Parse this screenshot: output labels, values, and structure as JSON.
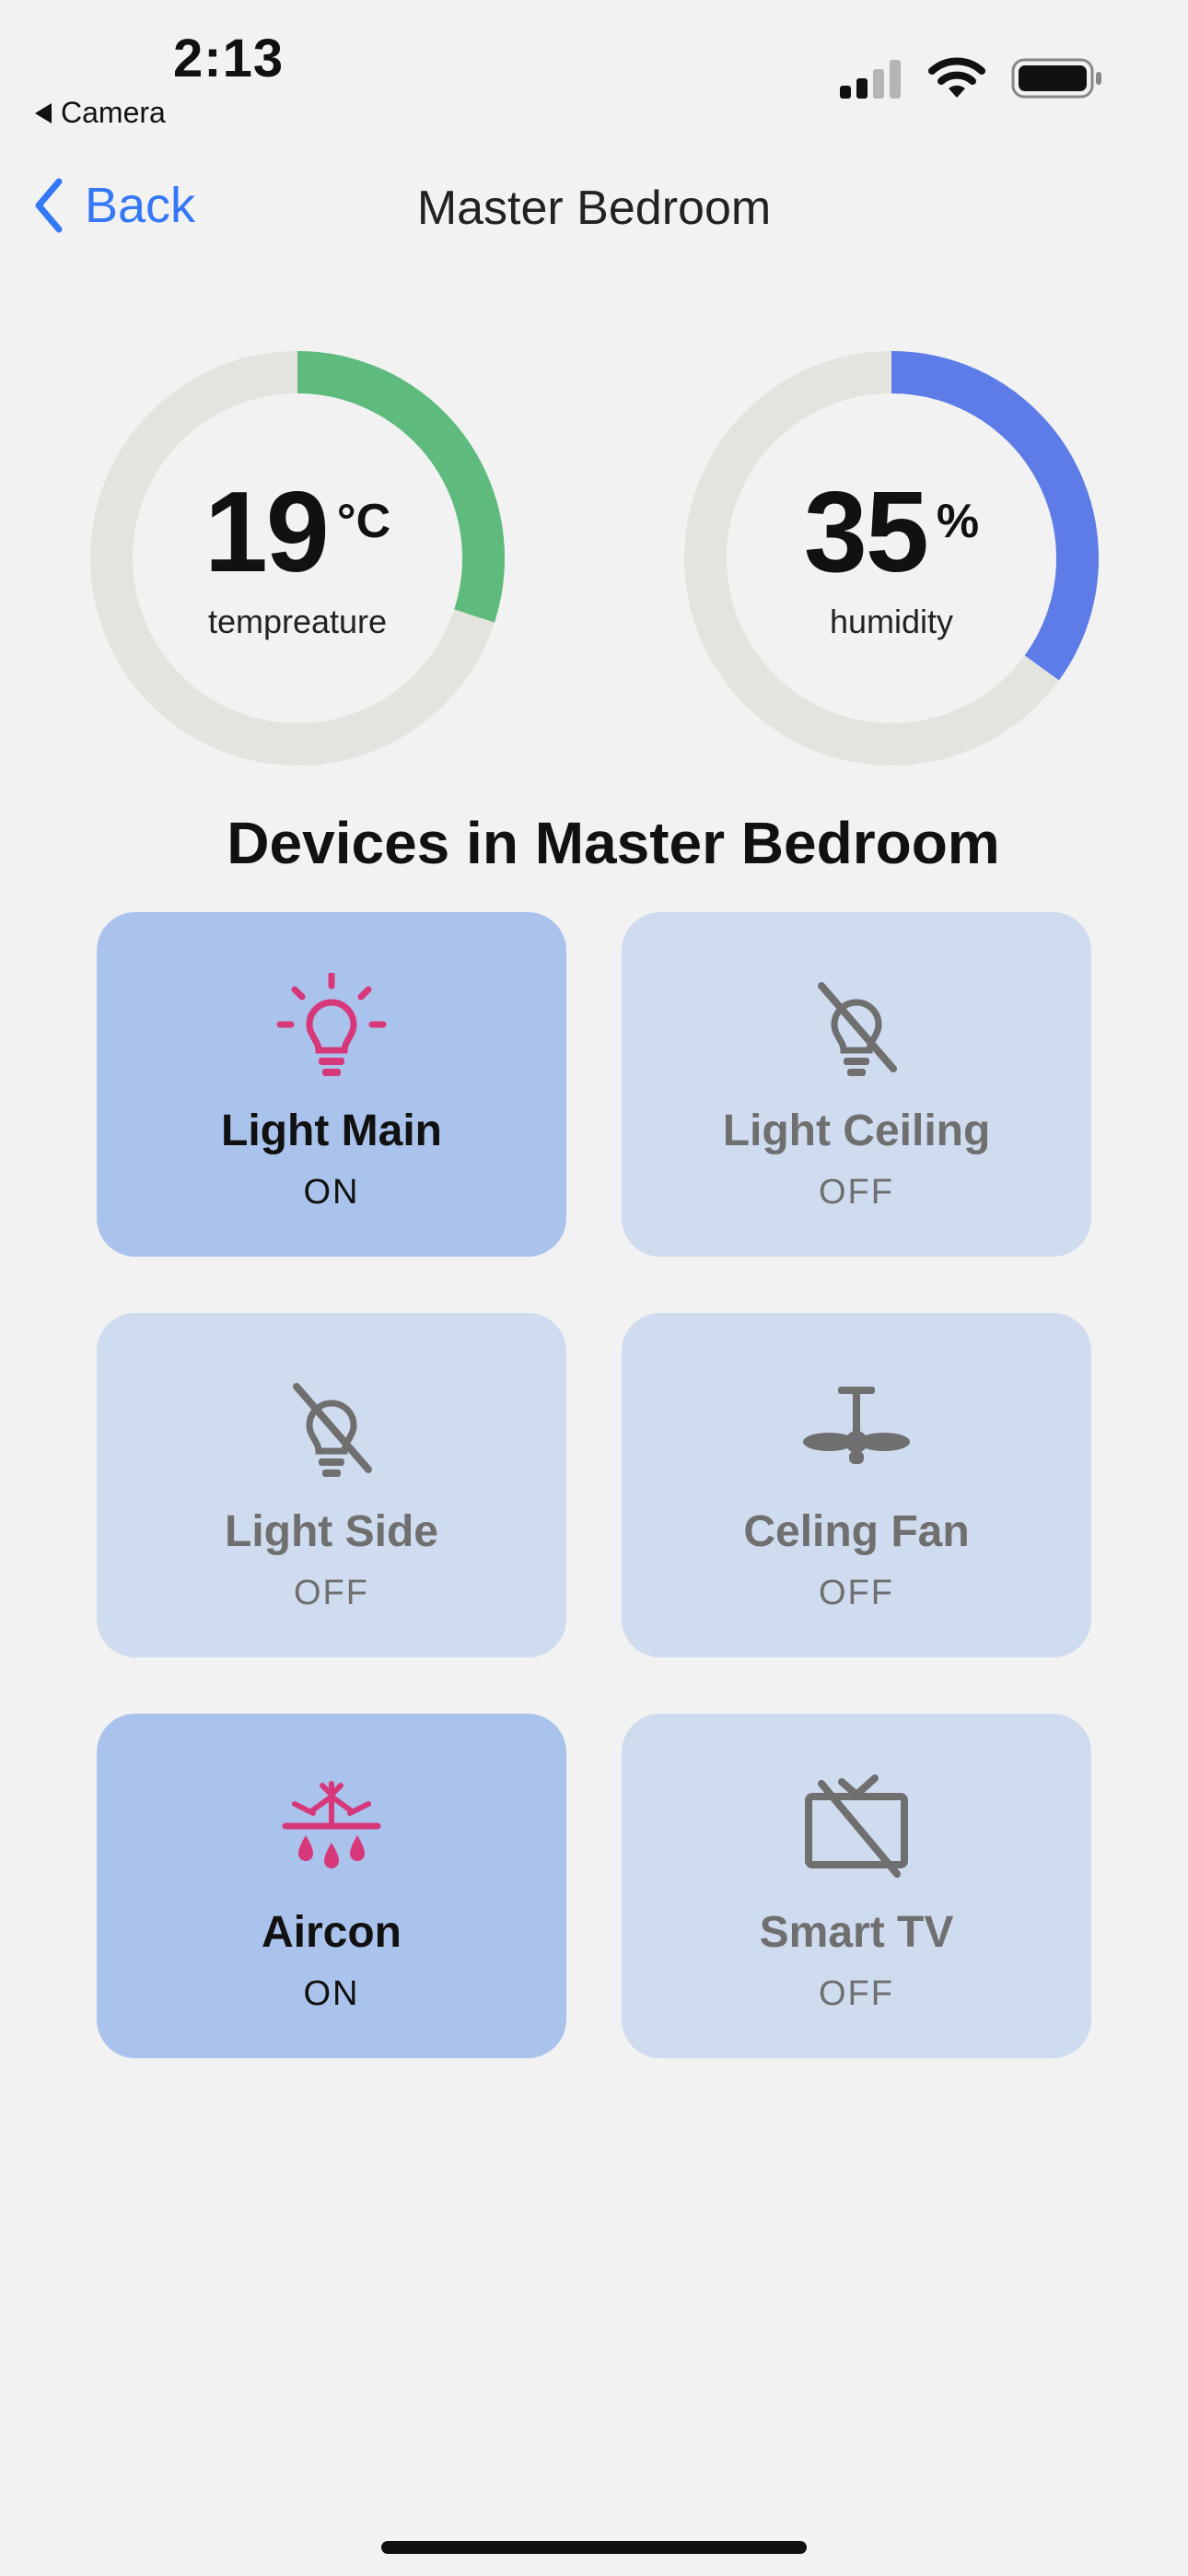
{
  "status_bar": {
    "time": "2:13",
    "back_app": "Camera",
    "icons": [
      "cellular-signal-icon",
      "wifi-icon",
      "battery-icon"
    ]
  },
  "nav": {
    "back_label": "Back",
    "title": "Master Bedroom"
  },
  "gauges": {
    "temperature": {
      "value": "19",
      "unit": "°C",
      "label": "tempreature",
      "fill_fraction": 0.3,
      "color": "#5ebb7d"
    },
    "humidity": {
      "value": "35",
      "unit": "%",
      "label": "humidity",
      "fill_fraction": 0.35,
      "color": "#5e7ce8"
    },
    "track_color": "#e4e4de"
  },
  "section_title": "Devices in Master Bedroom",
  "devices": [
    {
      "name": "Light Main",
      "state": "ON",
      "icon": "lightbulb-on-icon"
    },
    {
      "name": "Light Ceiling",
      "state": "OFF",
      "icon": "lightbulb-off-icon"
    },
    {
      "name": "Light Side",
      "state": "OFF",
      "icon": "lightbulb-off-icon"
    },
    {
      "name": "Celing Fan",
      "state": "OFF",
      "icon": "ceiling-fan-icon"
    },
    {
      "name": "Aircon",
      "state": "ON",
      "icon": "aircon-icon"
    },
    {
      "name": "Smart TV",
      "state": "OFF",
      "icon": "tv-off-icon"
    }
  ],
  "colors": {
    "accent": "#3478f6",
    "card_on": "#aac3ec",
    "card_off": "#cfdbef",
    "icon_on": "#d6387a",
    "icon_off": "#6f6f6f"
  }
}
